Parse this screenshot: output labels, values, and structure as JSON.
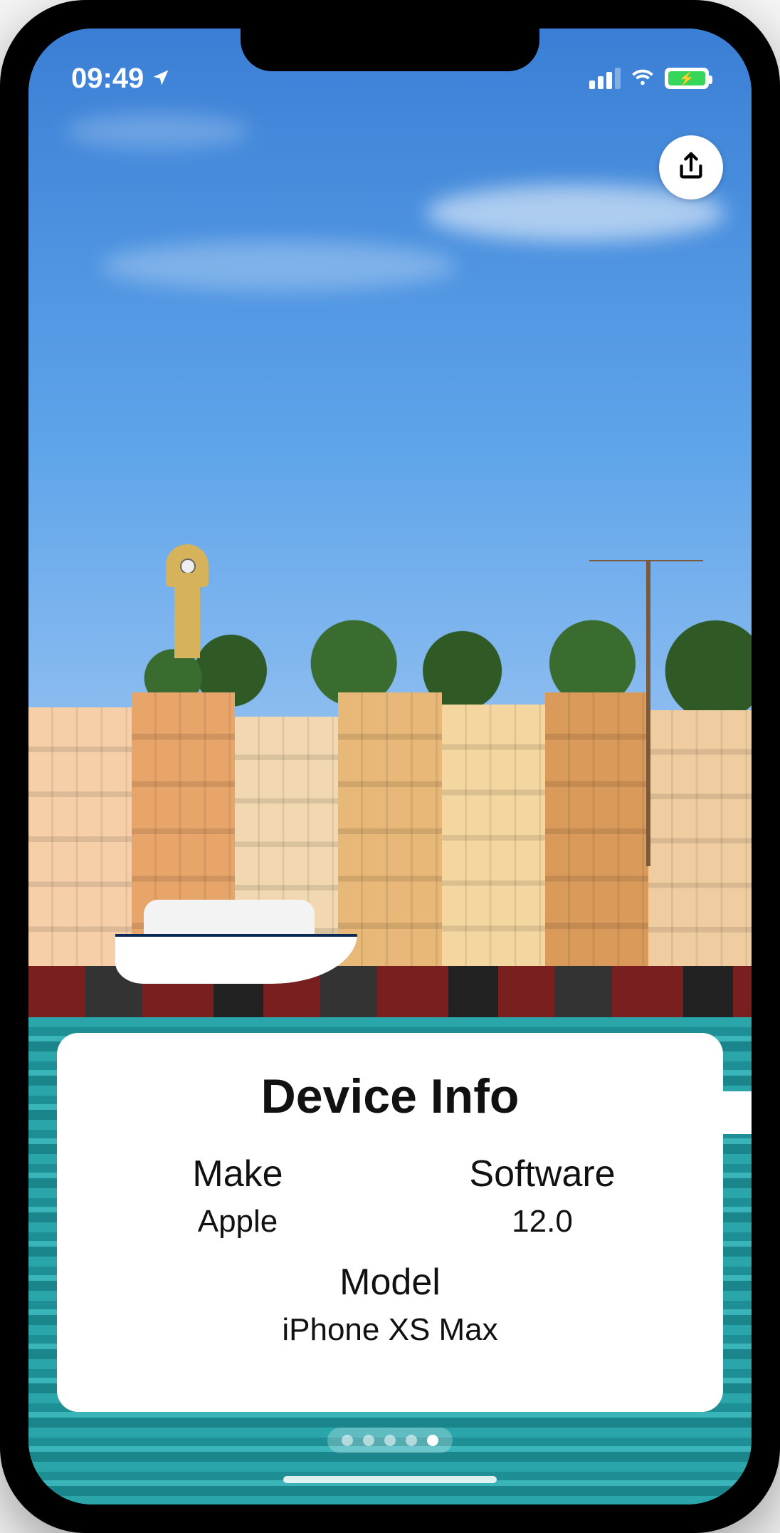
{
  "status": {
    "time": "09:49",
    "location_icon": "location-arrow",
    "signal_bars": 3,
    "wifi": true,
    "battery_charging": true
  },
  "share": {
    "label": "Share"
  },
  "card": {
    "title": "Device Info",
    "make_label": "Make",
    "make_value": "Apple",
    "software_label": "Software",
    "software_value": "12.0",
    "model_label": "Model",
    "model_value": "iPhone XS Max"
  },
  "pager": {
    "count": 5,
    "active_index": 4
  }
}
